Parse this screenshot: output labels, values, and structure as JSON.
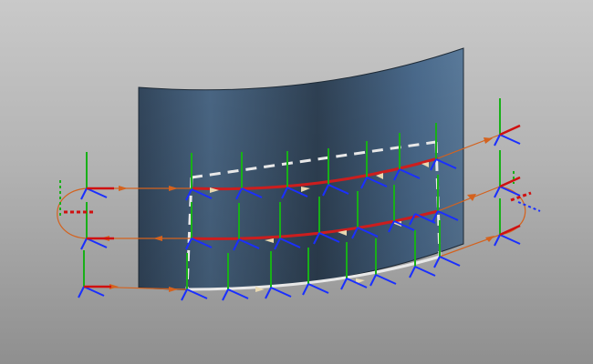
{
  "viewport": {
    "background_top": "#c9c9c9",
    "background_bottom": "#8f8f8f"
  },
  "colors": {
    "surface_light": "#5a7a9a",
    "surface_dark": "#33475d",
    "surface_edge": "#1e2a36",
    "toolpath_cut": "#cc1e1e",
    "toolpath_link": "#d4621e",
    "boundary": "#e8e8e8",
    "axis_x": "#d01010",
    "axis_y": "#18b018",
    "axis_z": "#1a2fff"
  },
  "scene": {
    "surface": "curved-blue-surface",
    "toolpath_passes": 3,
    "boundary_style": "dashed-white",
    "tool_axis_glyphs": [
      "tool-axis-x",
      "tool-axis-y",
      "tool-axis-z"
    ]
  }
}
